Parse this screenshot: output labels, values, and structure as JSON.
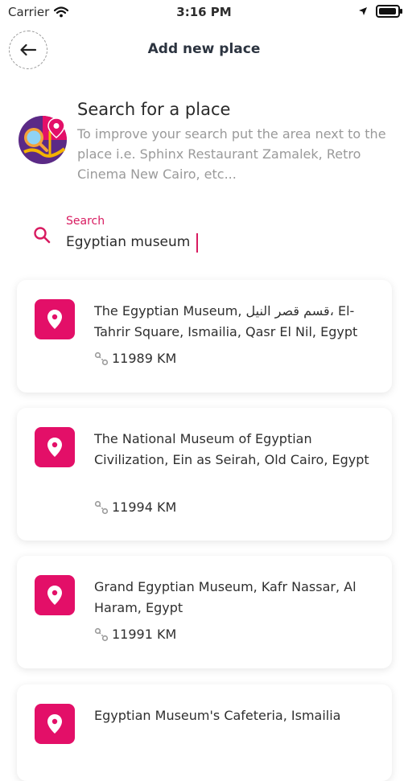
{
  "status_bar": {
    "carrier": "Carrier",
    "time": "3:16 PM",
    "icons": [
      "wifi-icon",
      "location-arrow-icon",
      "battery-icon"
    ]
  },
  "header": {
    "title": "Add new place",
    "back_icon": "arrow-left-icon"
  },
  "hero": {
    "title": "Search for a place",
    "description": "To improve your search put the area next to the place i.e. Sphinx Restaurant Zamalek, Retro Cinema New Cairo, etc...",
    "icon": "map-search-illustration-icon"
  },
  "search": {
    "label": "Search",
    "value": "Egyptian museum",
    "icon": "search-icon"
  },
  "results": [
    {
      "name": "The Egyptian Museum, قسم قصر النيل، El-Tahrir Square, Ismailia, Qasr El Nil, Egypt",
      "distance": "11989 KM"
    },
    {
      "name": "The National Museum of Egyptian Civilization, Ein as Seirah, Old Cairo, Egypt",
      "distance": "11994 KM"
    },
    {
      "name": "Grand Egyptian Museum, Kafr Nassar, Al Haram, Egypt",
      "distance": "11991 KM"
    },
    {
      "name": "Egyptian Museum's Cafeteria, Ismailia",
      "distance": ""
    }
  ],
  "colors": {
    "accent": "#e30f68",
    "search_label": "#d81b60",
    "title_text": "#2c3440",
    "hint_text": "#9a9a9a"
  }
}
